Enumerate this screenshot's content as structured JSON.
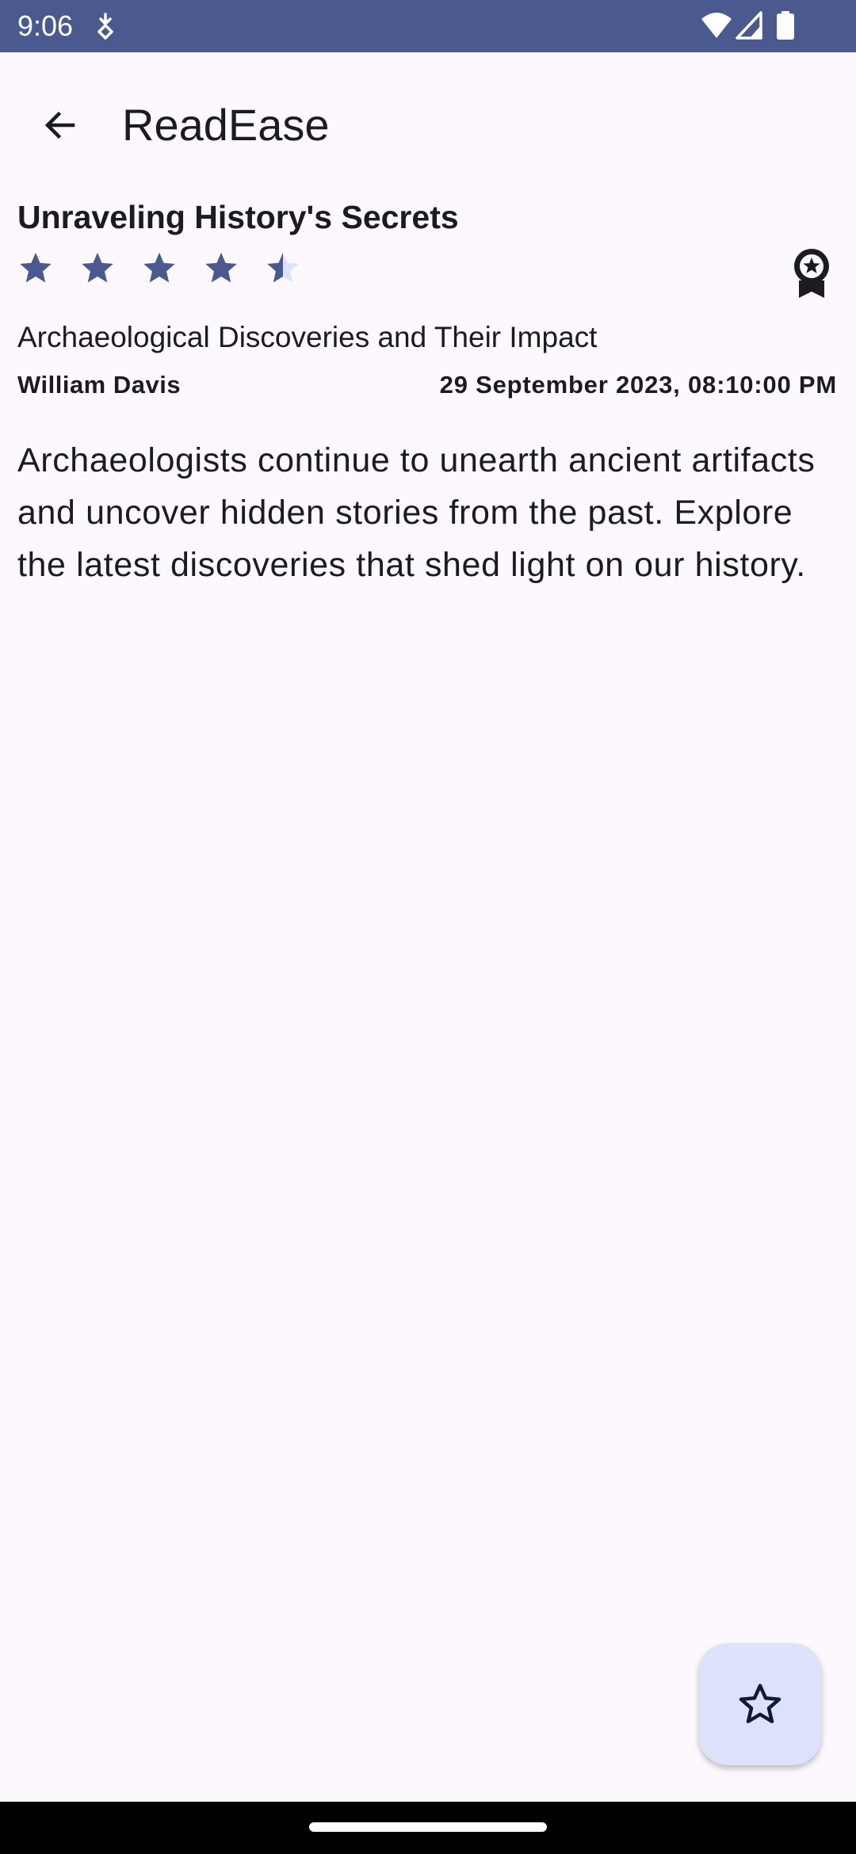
{
  "status_bar": {
    "time": "9:06",
    "icons": [
      "drive-icon",
      "wifi-icon",
      "signal-icon",
      "battery-icon"
    ],
    "background_color": "#4a5a8e"
  },
  "app_bar": {
    "title": "ReadEase",
    "back_icon": "arrow-back-icon"
  },
  "article": {
    "title": "Unraveling History's Secrets",
    "rating": {
      "value": 4.5,
      "max": 5
    },
    "award_icon": "award-badge-icon",
    "subtitle": "Archaeological Discoveries and Their Impact",
    "author": "William Davis",
    "date": "29 September 2023, 08:10:00 PM",
    "body": "Archaeologists continue to unearth ancient artifacts and uncover hidden stories from the past. Explore the latest discoveries that shed light on our history."
  },
  "fab": {
    "icon": "star-outline-icon",
    "background_color": "#dde2fb"
  },
  "colors": {
    "accent": "#4a5a8e",
    "star_empty": "#dde2fb",
    "background": "#fcf8fd"
  }
}
